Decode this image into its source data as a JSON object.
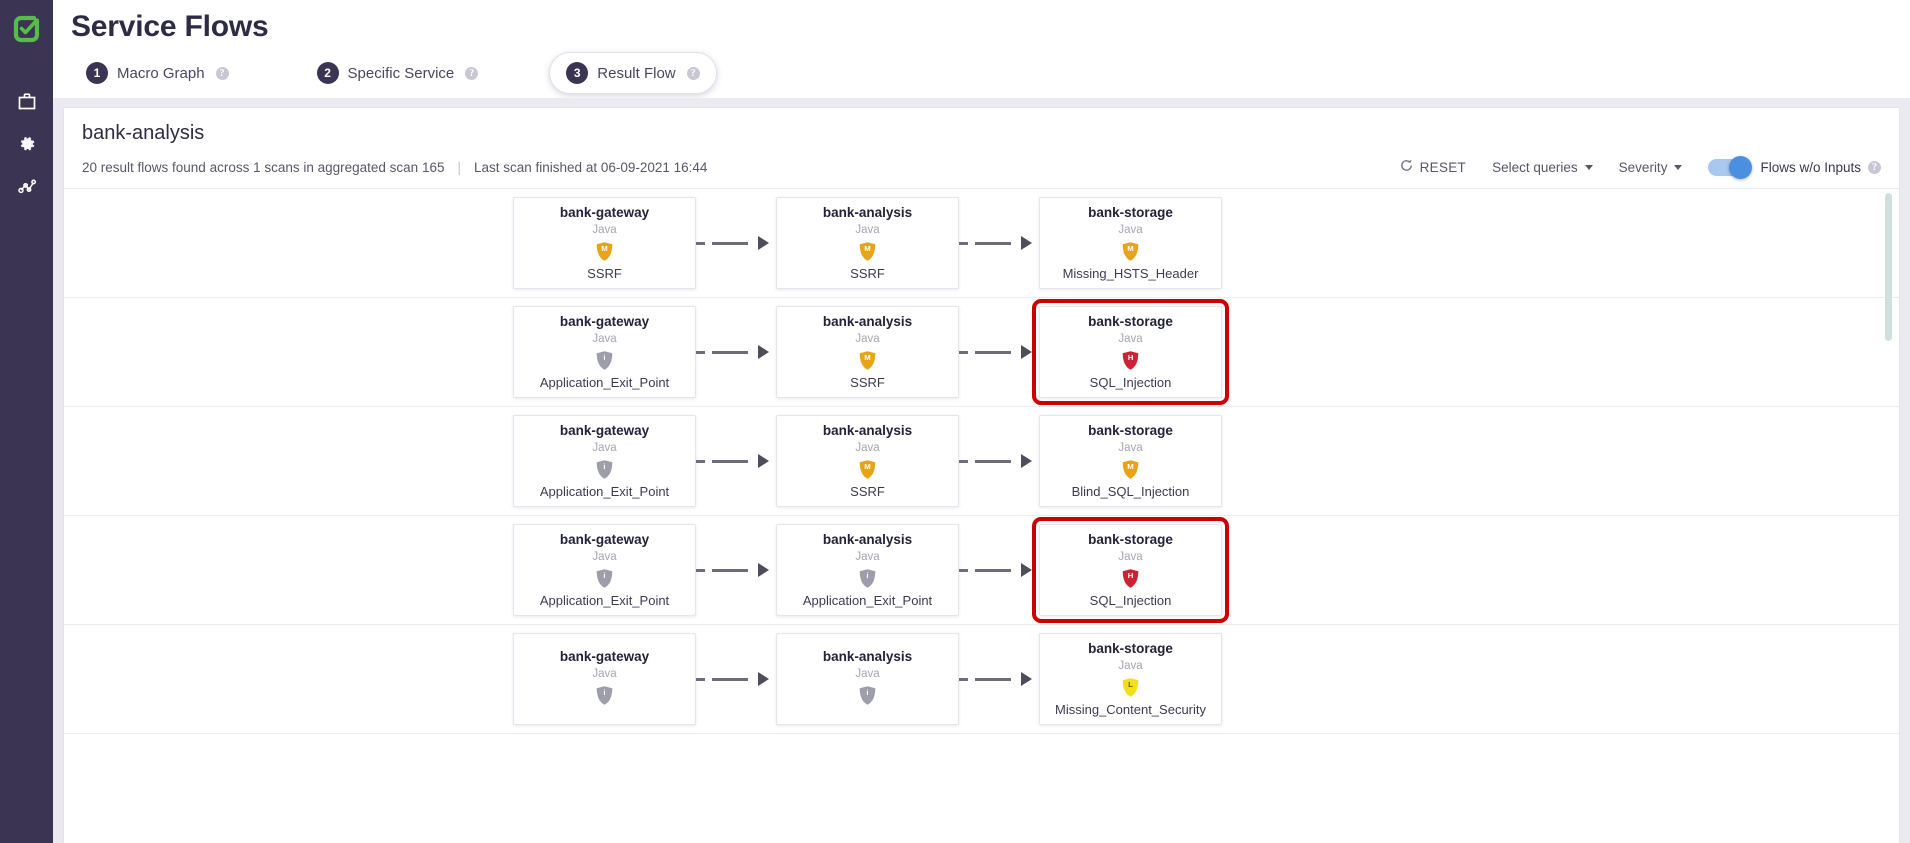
{
  "rail": {
    "logo_icon": "checkmark-logo",
    "items": [
      {
        "icon": "briefcase-icon",
        "name": "projects"
      },
      {
        "icon": "gear-icon",
        "name": "settings"
      },
      {
        "icon": "analytics-graph-icon",
        "name": "analytics"
      }
    ]
  },
  "header": {
    "title": "Service Flows",
    "steps": [
      {
        "num": "1",
        "label": "Macro Graph",
        "help": "?",
        "active": false
      },
      {
        "num": "2",
        "label": "Specific Service",
        "help": "?",
        "active": false
      },
      {
        "num": "3",
        "label": "Result Flow",
        "help": "?",
        "active": true
      }
    ]
  },
  "panel": {
    "title": "bank-analysis",
    "summary": "20 result flows found across 1 scans in aggregated scan 165",
    "divider": "|",
    "last_scan": "Last scan finished at 06-09-2021 16:44",
    "toolbar": {
      "reset_label": "RESET",
      "reset_icon": "refresh-icon",
      "select_queries_label": "Select queries",
      "severity_label": "Severity",
      "toggle_on": true,
      "toggle_label": "Flows w/o Inputs",
      "toggle_help": "?"
    }
  },
  "severity_colors": {
    "high": "#cc2233",
    "medium": "#e8a317",
    "low": "#f2e014",
    "info": "#9e9eaa"
  },
  "flows": [
    {
      "flagged": false,
      "nodes": [
        {
          "service": "bank-gateway",
          "lang": "Java",
          "severity": "medium",
          "severity_letter": "M",
          "query": "SSRF"
        },
        {
          "service": "bank-analysis",
          "lang": "Java",
          "severity": "medium",
          "severity_letter": "M",
          "query": "SSRF"
        },
        {
          "service": "bank-storage",
          "lang": "Java",
          "severity": "medium",
          "severity_letter": "M",
          "query": "Missing_HSTS_Header"
        }
      ]
    },
    {
      "flagged": true,
      "nodes": [
        {
          "service": "bank-gateway",
          "lang": "Java",
          "severity": "info",
          "severity_letter": "i",
          "query": "Application_Exit_Point"
        },
        {
          "service": "bank-analysis",
          "lang": "Java",
          "severity": "medium",
          "severity_letter": "M",
          "query": "SSRF"
        },
        {
          "service": "bank-storage",
          "lang": "Java",
          "severity": "high",
          "severity_letter": "H",
          "query": "SQL_Injection"
        }
      ]
    },
    {
      "flagged": false,
      "nodes": [
        {
          "service": "bank-gateway",
          "lang": "Java",
          "severity": "info",
          "severity_letter": "i",
          "query": "Application_Exit_Point"
        },
        {
          "service": "bank-analysis",
          "lang": "Java",
          "severity": "medium",
          "severity_letter": "M",
          "query": "SSRF"
        },
        {
          "service": "bank-storage",
          "lang": "Java",
          "severity": "medium",
          "severity_letter": "M",
          "query": "Blind_SQL_Injection"
        }
      ]
    },
    {
      "flagged": true,
      "nodes": [
        {
          "service": "bank-gateway",
          "lang": "Java",
          "severity": "info",
          "severity_letter": "i",
          "query": "Application_Exit_Point"
        },
        {
          "service": "bank-analysis",
          "lang": "Java",
          "severity": "info",
          "severity_letter": "i",
          "query": "Application_Exit_Point"
        },
        {
          "service": "bank-storage",
          "lang": "Java",
          "severity": "high",
          "severity_letter": "H",
          "query": "SQL_Injection"
        }
      ]
    },
    {
      "flagged": false,
      "nodes": [
        {
          "service": "bank-gateway",
          "lang": "Java",
          "severity": "info",
          "severity_letter": "i",
          "query": ""
        },
        {
          "service": "bank-analysis",
          "lang": "Java",
          "severity": "info",
          "severity_letter": "i",
          "query": ""
        },
        {
          "service": "bank-storage",
          "lang": "Java",
          "severity": "low",
          "severity_letter": "L",
          "query": "Missing_Content_Security"
        }
      ]
    }
  ]
}
